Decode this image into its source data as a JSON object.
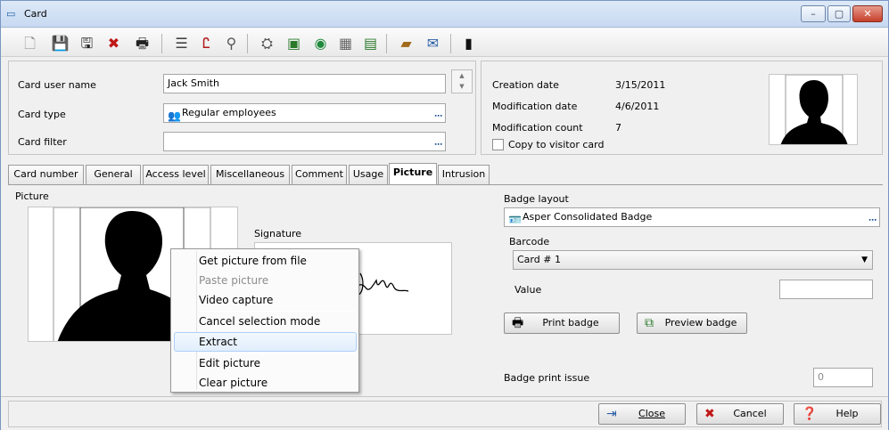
{
  "window": {
    "title": "Card",
    "title_icon": "card-icon"
  },
  "title_buttons": {
    "minimize": "–",
    "maximize": "▢",
    "close": "✕"
  },
  "toolbar": {
    "icons": [
      "new-icon",
      "save-icon",
      "save-close-icon",
      "delete-icon",
      "print-icon",
      "list-icon",
      "link-icon",
      "search-icon",
      "badge-icon",
      "export-icon",
      "refresh-icon",
      "grid-icon",
      "chart-icon",
      "folder-icon",
      "mail-icon",
      "door-icon"
    ],
    "glyphs": [
      "📄",
      "💾",
      "🗎",
      "✖",
      "🖶",
      "☰",
      "🔗",
      "🔍",
      "🪪",
      "📤",
      "⟳",
      "▦",
      "📊",
      "📁",
      "🔖",
      "▮"
    ]
  },
  "card": {
    "user_name_label": "Card user name",
    "user_name_value": "Jack Smith",
    "type_label": "Card type",
    "type_value": "Regular employees",
    "filter_label": "Card filter",
    "filter_value": "",
    "ellipsis": "⋯"
  },
  "info": {
    "creation_label": "Creation date",
    "creation_value": "3/15/2011",
    "modification_label": "Modification date",
    "modification_value": "4/6/2011",
    "count_label": "Modification count",
    "count_value": "7",
    "copy_label": "Copy to visitor card"
  },
  "tabs": [
    {
      "label": "Card number",
      "active": false
    },
    {
      "label": "General",
      "active": false
    },
    {
      "label": "Access level",
      "active": false
    },
    {
      "label": "Miscellaneous",
      "active": false
    },
    {
      "label": "Comment",
      "active": false
    },
    {
      "label": "Usage",
      "active": false
    },
    {
      "label": "Picture",
      "active": true
    },
    {
      "label": "Intrusion",
      "active": false
    }
  ],
  "picture_tab": {
    "picture_label": "Picture",
    "signature_label": "Signature",
    "badge_layout_label": "Badge layout",
    "badge_layout_value": "Asper Consolidated Badge",
    "barcode_label": "Barcode",
    "barcode_value": "Card # 1",
    "value_label": "Value",
    "value_value": "",
    "print_badge": "Print badge",
    "preview_badge": "Preview badge",
    "badge_print_issue_label": "Badge print issue",
    "badge_print_issue_value": "0"
  },
  "context_menu": {
    "items": [
      {
        "label": "Get picture from file",
        "disabled": false
      },
      {
        "label": "Paste picture",
        "disabled": true
      },
      {
        "label": "Video capture",
        "disabled": false
      },
      {
        "label": "Cancel selection mode",
        "disabled": false
      },
      {
        "label": "Extract",
        "disabled": false,
        "highlighted": true
      },
      {
        "label": "Edit picture",
        "disabled": false
      },
      {
        "label": "Clear picture",
        "disabled": false
      }
    ]
  },
  "footer": {
    "close": "Close",
    "cancel": "Cancel",
    "help": "Help"
  }
}
